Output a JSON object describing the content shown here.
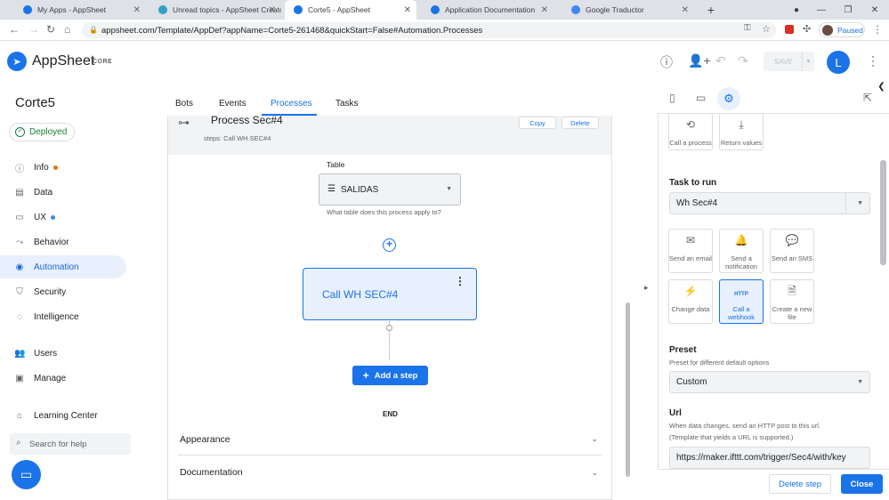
{
  "browser": {
    "tabs": [
      {
        "title": "My Apps - AppSheet",
        "color": "#1a73e8"
      },
      {
        "title": "Unread topics - AppSheet Creato",
        "color": "#34a0c6"
      },
      {
        "title": "Corte5 - AppSheet",
        "color": "#1a73e8"
      },
      {
        "title": "Application Documentation",
        "color": "#1a73e8"
      },
      {
        "title": "Google Traductor",
        "color": "#4285f4"
      }
    ],
    "new_tab": "+",
    "url": "appsheet.com/Template/AppDef?appName=Corte5-261468&quickStart=False#Automation.Processes",
    "profile_status": "Paused"
  },
  "app": {
    "brand": "AppSheet",
    "edition": "CORE",
    "save_label": "SAVE",
    "user_initial": "L"
  },
  "sidebar": {
    "app_name": "Corte5",
    "status": "Deployed",
    "items": [
      {
        "label": "Info",
        "icon": "info-icon",
        "glyph": "ⓘ",
        "dot": "#e8710a"
      },
      {
        "label": "Data",
        "icon": "database-icon",
        "glyph": "▤",
        "dot": ""
      },
      {
        "label": "UX",
        "icon": "phone-icon",
        "glyph": "▭",
        "dot": "#4285f4"
      },
      {
        "label": "Behavior",
        "icon": "behavior-icon",
        "glyph": "⤳",
        "dot": ""
      },
      {
        "label": "Automation",
        "icon": "automation-icon",
        "glyph": "◉",
        "dot": "",
        "active": true
      },
      {
        "label": "Security",
        "icon": "shield-icon",
        "glyph": "⛉",
        "dot": ""
      },
      {
        "label": "Intelligence",
        "icon": "bulb-icon",
        "glyph": "◌",
        "dot": ""
      },
      {
        "label": "Users",
        "icon": "users-icon",
        "glyph": "👥",
        "dot": ""
      },
      {
        "label": "Manage",
        "icon": "manage-icon",
        "glyph": "▣",
        "dot": ""
      },
      {
        "label": "Learning Center",
        "icon": "school-icon",
        "glyph": "⌂",
        "dot": ""
      }
    ],
    "search_placeholder": "Search for help"
  },
  "main": {
    "tabs": [
      "Bots",
      "Events",
      "Processes",
      "Tasks"
    ],
    "active_tab": "Processes",
    "process": {
      "title": "Process Sec#4",
      "steps": "steps: Call WH SEC#4",
      "copy_label": "Copy",
      "delete_label": "Delete"
    },
    "table": {
      "label": "Table",
      "value": "SALIDAS",
      "help": "What table does this process apply to?"
    },
    "step_card": "Call WH SEC#4",
    "add_step": "Add a step",
    "end_label": "END",
    "sections": [
      "Appearance",
      "Documentation"
    ]
  },
  "panel": {
    "tiles_top": [
      {
        "label": "Call a process",
        "icon": "call-process-icon",
        "glyph": "⟲"
      },
      {
        "label": "Return values",
        "icon": "return-values-icon",
        "glyph": "⤓"
      }
    ],
    "task_label": "Task to run",
    "task_value": "Wh Sec#4",
    "tiles": [
      {
        "label": "Send an email",
        "icon": "email-icon",
        "glyph": "✉"
      },
      {
        "label": "Send a notification",
        "icon": "bell-icon",
        "glyph": "🔔"
      },
      {
        "label": "Send an SMS",
        "icon": "sms-icon",
        "glyph": "💬"
      },
      {
        "label": "Change data",
        "icon": "bolt-icon",
        "glyph": "⚡"
      },
      {
        "label": "Call a webhook",
        "icon": "http-icon",
        "glyph": "HTTP",
        "selected": true
      },
      {
        "label": "Create a new file",
        "icon": "new-file-icon",
        "glyph": "🗎"
      }
    ],
    "preset_label": "Preset",
    "preset_help": "Preset for different default options",
    "preset_value": "Custom",
    "url_label": "Url",
    "url_help_1": "When data changes, send an HTTP post to this url.",
    "url_help_2": "(Template that yields a URL is supported.)",
    "url_value": "https://maker.ifttt.com/trigger/Sec4/with/key",
    "delete_step": "Delete step",
    "close": "Close"
  }
}
